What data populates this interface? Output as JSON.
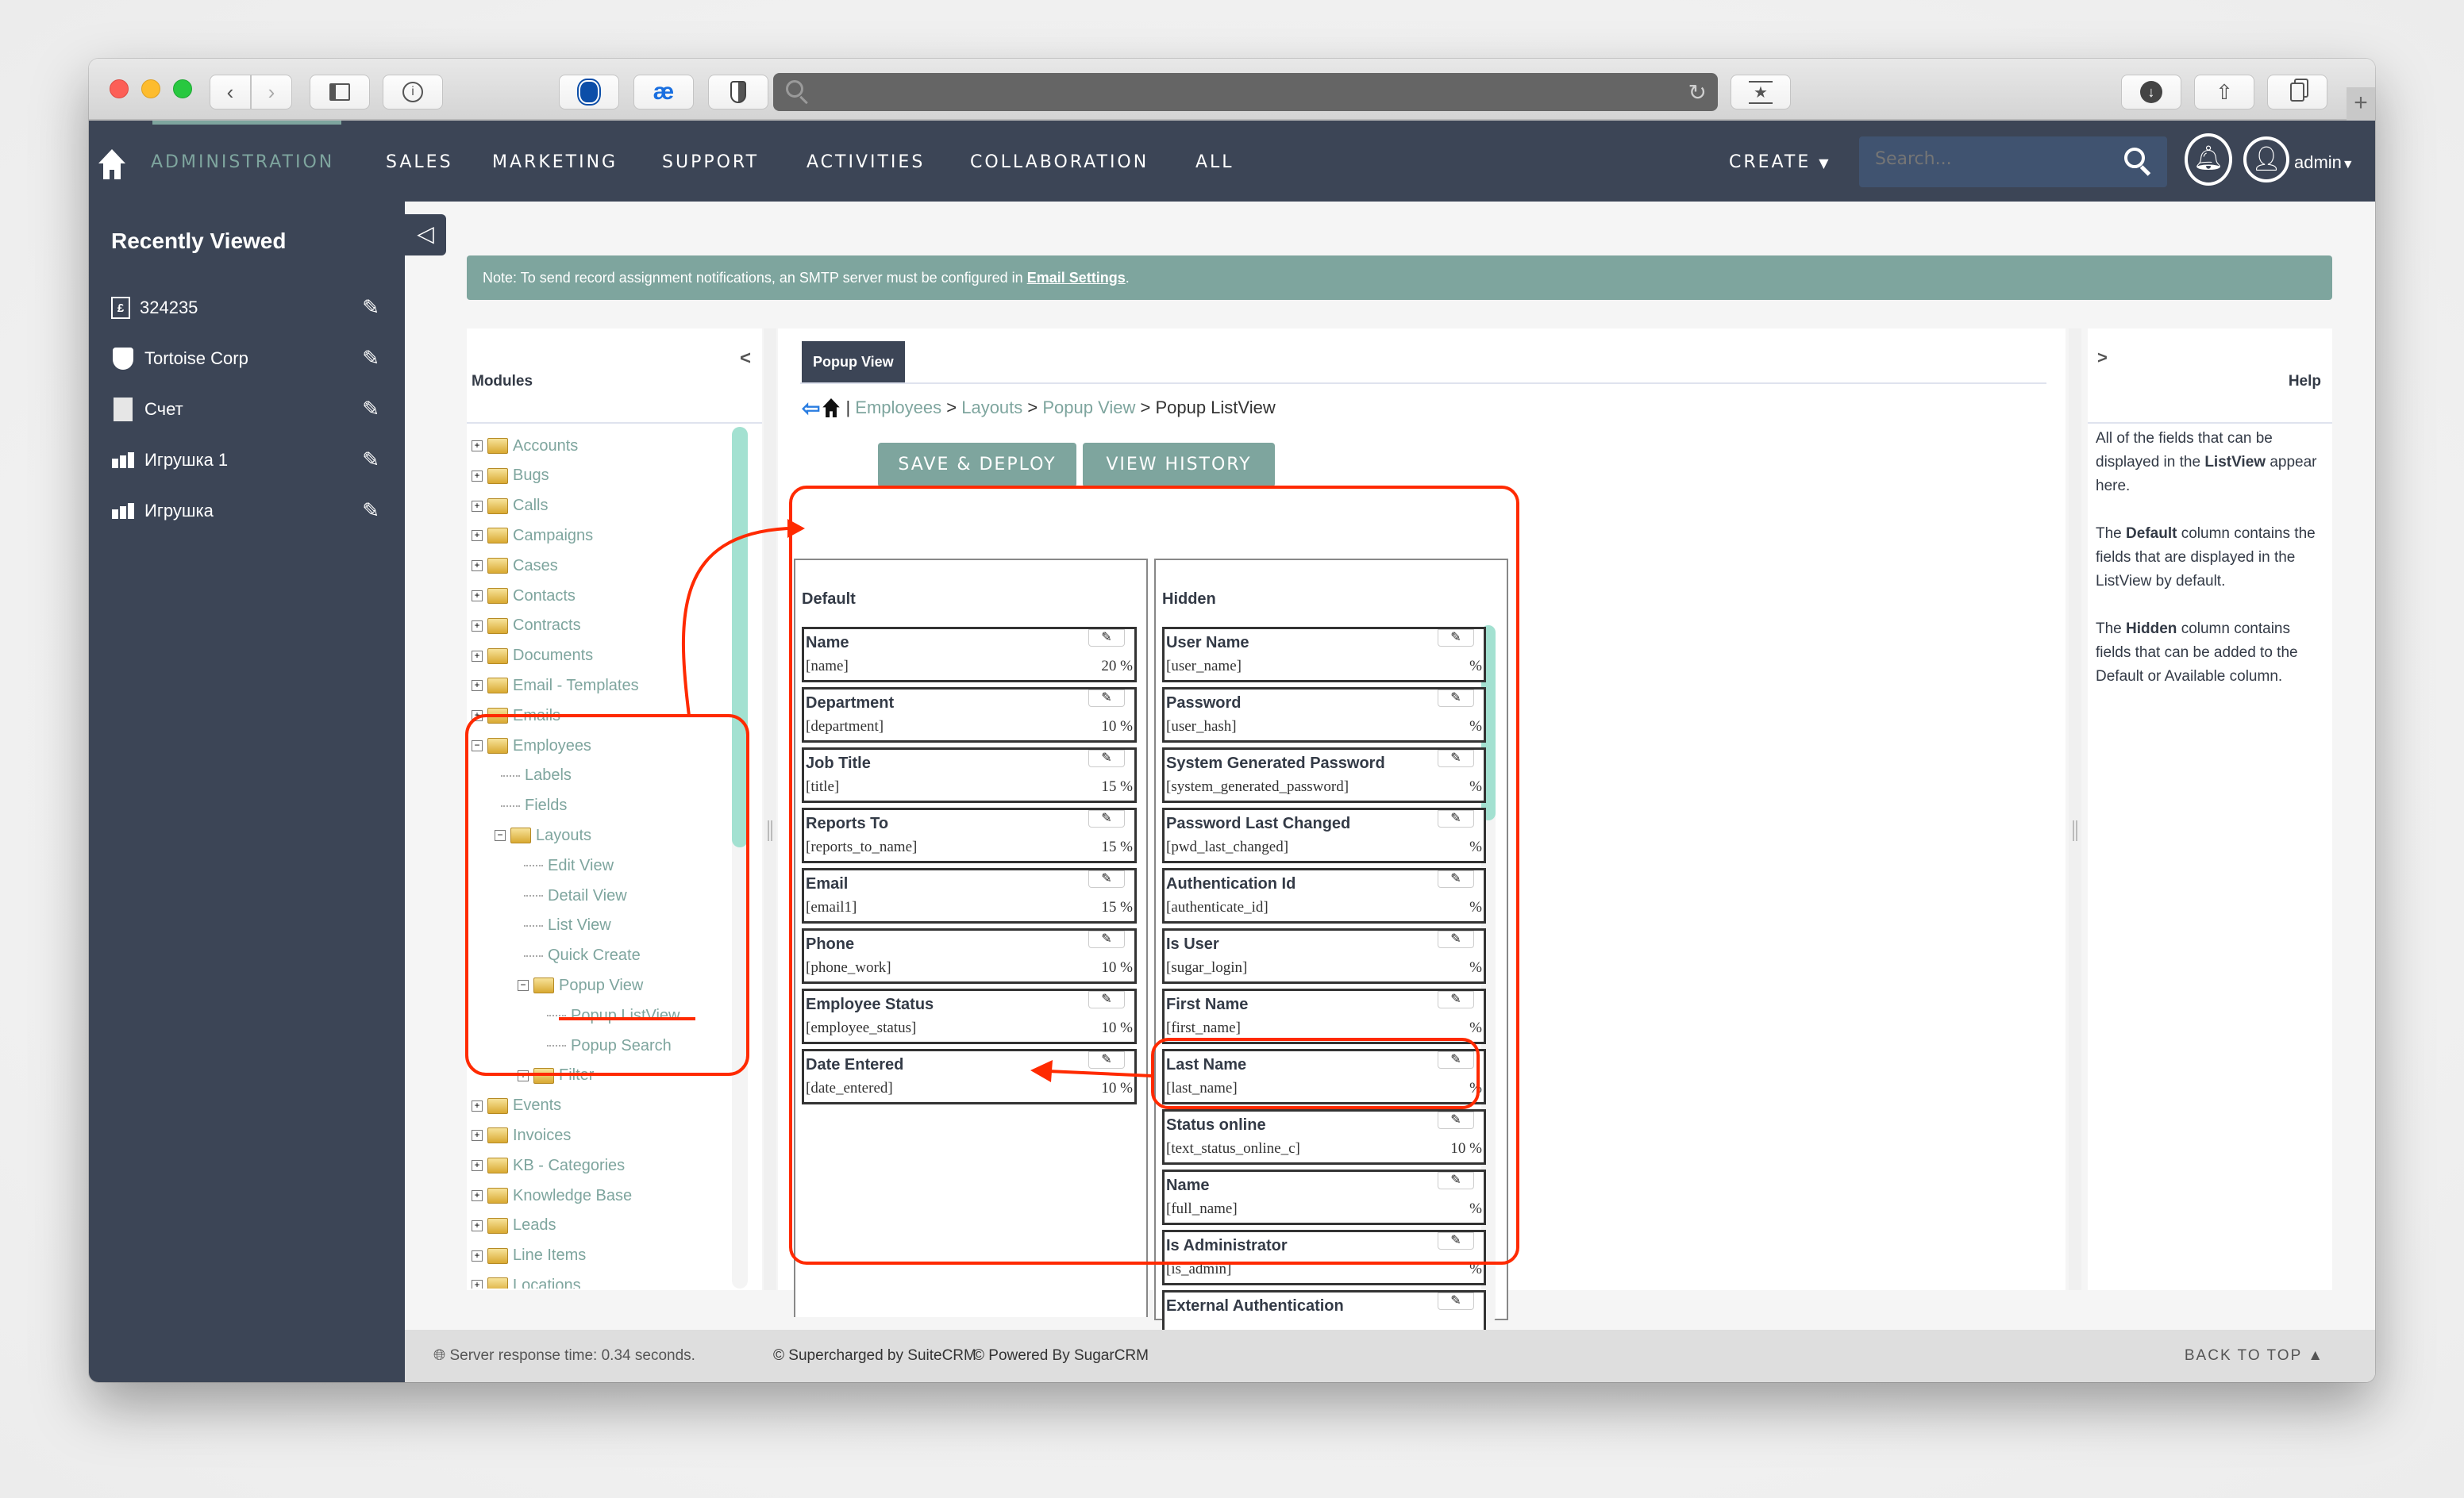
{
  "browser": {
    "buttons": [
      "back",
      "forward",
      "sidebar",
      "info",
      "adblock",
      "translate",
      "shield",
      "bookmark",
      "downloads",
      "share",
      "tabs",
      "new-tab"
    ],
    "address": ""
  },
  "topnav": {
    "items": [
      {
        "label": "ADMINISTRATION",
        "active": true
      },
      {
        "label": "SALES"
      },
      {
        "label": "MARKETING"
      },
      {
        "label": "SUPPORT"
      },
      {
        "label": "ACTIVITIES"
      },
      {
        "label": "COLLABORATION"
      },
      {
        "label": "ALL"
      }
    ],
    "create_label": "CREATE",
    "search_placeholder": "Search...",
    "user_label": "admin"
  },
  "sidebar": {
    "title": "Recently Viewed",
    "items": [
      {
        "label": "324235",
        "icon": "invoice-icon"
      },
      {
        "label": "Tortoise Corp",
        "icon": "shield-icon"
      },
      {
        "label": "Счет",
        "icon": "document-icon"
      },
      {
        "label": "Игрушка 1",
        "icon": "bar-chart-icon"
      },
      {
        "label": "Игрушка",
        "icon": "bar-chart-icon"
      }
    ]
  },
  "notice": {
    "text": "Note: To send record assignment notifications, an SMTP server must be configured in ",
    "link": "Email Settings",
    "suffix": "."
  },
  "modules": {
    "title": "Modules",
    "collapse": "<",
    "tree": [
      {
        "label": "Accounts",
        "level": 0,
        "type": "folder",
        "expanded": false
      },
      {
        "label": "Bugs",
        "level": 0,
        "type": "folder",
        "expanded": false
      },
      {
        "label": "Calls",
        "level": 0,
        "type": "folder",
        "expanded": false
      },
      {
        "label": "Campaigns",
        "level": 0,
        "type": "folder",
        "expanded": false
      },
      {
        "label": "Cases",
        "level": 0,
        "type": "folder",
        "expanded": false
      },
      {
        "label": "Contacts",
        "level": 0,
        "type": "folder",
        "expanded": false
      },
      {
        "label": "Contracts",
        "level": 0,
        "type": "folder",
        "expanded": false
      },
      {
        "label": "Documents",
        "level": 0,
        "type": "folder",
        "expanded": false
      },
      {
        "label": "Email - Templates",
        "level": 0,
        "type": "folder",
        "expanded": false
      },
      {
        "label": "Emails",
        "level": 0,
        "type": "folder",
        "expanded": false
      },
      {
        "label": "Employees",
        "level": 0,
        "type": "folder",
        "expanded": true
      },
      {
        "label": "Labels",
        "level": 1,
        "type": "leaf"
      },
      {
        "label": "Fields",
        "level": 1,
        "type": "leaf"
      },
      {
        "label": "Layouts",
        "level": 1,
        "type": "folder",
        "expanded": true
      },
      {
        "label": "Edit View",
        "level": 2,
        "type": "leaf"
      },
      {
        "label": "Detail View",
        "level": 2,
        "type": "leaf"
      },
      {
        "label": "List View",
        "level": 2,
        "type": "leaf"
      },
      {
        "label": "Quick Create",
        "level": 2,
        "type": "leaf"
      },
      {
        "label": "Popup View",
        "level": 2,
        "type": "folder",
        "expanded": true
      },
      {
        "label": "Popup ListView",
        "level": 3,
        "type": "leaf",
        "selected": true
      },
      {
        "label": "Popup Search",
        "level": 3,
        "type": "leaf"
      },
      {
        "label": "Filter",
        "level": 2,
        "type": "folder",
        "expanded": false
      },
      {
        "label": "Events",
        "level": 0,
        "type": "folder",
        "expanded": false
      },
      {
        "label": "Invoices",
        "level": 0,
        "type": "folder",
        "expanded": false
      },
      {
        "label": "KB - Categories",
        "level": 0,
        "type": "folder",
        "expanded": false
      },
      {
        "label": "Knowledge Base",
        "level": 0,
        "type": "folder",
        "expanded": false
      },
      {
        "label": "Leads",
        "level": 0,
        "type": "folder",
        "expanded": false
      },
      {
        "label": "Line Items",
        "level": 0,
        "type": "folder",
        "expanded": false
      },
      {
        "label": "Locations",
        "level": 0,
        "type": "folder",
        "expanded": false
      }
    ]
  },
  "main": {
    "tab": "Popup View",
    "breadcrumb": {
      "links": [
        "Employees",
        "Layouts",
        "Popup View"
      ],
      "current": "Popup ListView",
      "separator": ">"
    },
    "buttons": {
      "save": "SAVE & DEPLOY",
      "history": "VIEW HISTORY"
    },
    "default_column": {
      "title": "Default",
      "fields": [
        {
          "label": "Name",
          "name": "[name]",
          "width": "20 %"
        },
        {
          "label": "Department",
          "name": "[department]",
          "width": "10 %"
        },
        {
          "label": "Job Title",
          "name": "[title]",
          "width": "15 %"
        },
        {
          "label": "Reports To",
          "name": "[reports_to_name]",
          "width": "15 %"
        },
        {
          "label": "Email",
          "name": "[email1]",
          "width": "15 %"
        },
        {
          "label": "Phone",
          "name": "[phone_work]",
          "width": "10 %"
        },
        {
          "label": "Employee Status",
          "name": "[employee_status]",
          "width": "10 %"
        },
        {
          "label": "Date Entered",
          "name": "[date_entered]",
          "width": "10 %"
        }
      ]
    },
    "hidden_column": {
      "title": "Hidden",
      "fields": [
        {
          "label": "User Name",
          "name": "[user_name]",
          "width": "%"
        },
        {
          "label": "Password",
          "name": "[user_hash]",
          "width": "%"
        },
        {
          "label": "System Generated Password",
          "name": "[system_generated_password]",
          "width": "%"
        },
        {
          "label": "Password Last Changed",
          "name": "[pwd_last_changed]",
          "width": "%"
        },
        {
          "label": "Authentication Id",
          "name": "[authenticate_id]",
          "width": "%"
        },
        {
          "label": "Is User",
          "name": "[sugar_login]",
          "width": "%"
        },
        {
          "label": "First Name",
          "name": "[first_name]",
          "width": "%"
        },
        {
          "label": "Last Name",
          "name": "[last_name]",
          "width": "%"
        },
        {
          "label": "Status online",
          "name": "[text_status_online_c]",
          "width": "10 %",
          "highlighted": true
        },
        {
          "label": "Name",
          "name": "[full_name]",
          "width": "%"
        },
        {
          "label": "Is Administrator",
          "name": "[is_admin]",
          "width": "%"
        },
        {
          "label": "External Authentication",
          "name": "",
          "width": ""
        }
      ]
    }
  },
  "help": {
    "toggle": ">",
    "title": "Help",
    "paragraphs": [
      {
        "pre": "All of the fields that can be displayed in the ",
        "bold": "ListView",
        "post": " appear here."
      },
      {
        "pre": "The ",
        "bold": "Default",
        "post": " column contains the fields that are displayed in the ListView by default."
      },
      {
        "pre": "The ",
        "bold": "Hidden",
        "post": " column contains fields that can be added to the Default or Available column."
      }
    ]
  },
  "footer": {
    "server": "Server response time: 0.34 seconds.",
    "suitecrm": "© Supercharged by SuiteCRM",
    "sugarcrm": "© Powered By SugarCRM",
    "back_to_top": "BACK TO TOP"
  },
  "colors": {
    "nav_bg": "#3c4556",
    "accent": "#7ea59e",
    "scroll_thumb": "#a3e1d1",
    "annotation": "#ff2a00"
  }
}
